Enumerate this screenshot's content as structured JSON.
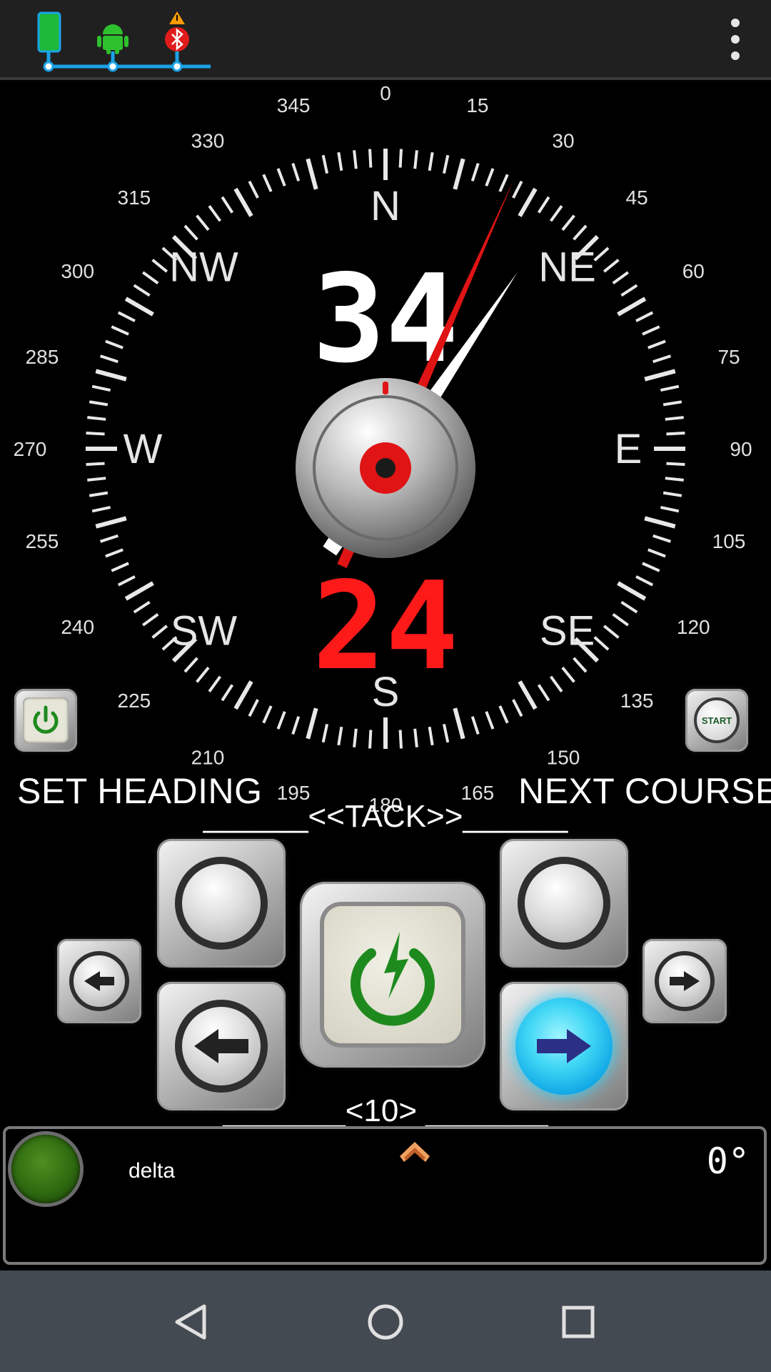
{
  "status": {
    "icons": [
      "phone-icon",
      "android-icon",
      "bluetooth-icon",
      "warning-icon"
    ],
    "accent_color": "#1aa3e8"
  },
  "menu": {
    "overflow": "overflow-menu-icon"
  },
  "compass": {
    "heading": "34",
    "course": "24",
    "heading_color": "#ffffff",
    "course_color": "#ff1a1a",
    "cardinals": {
      "N": "N",
      "NE": "NE",
      "E": "E",
      "SE": "SE",
      "S": "S",
      "SW": "SW",
      "W": "W",
      "NW": "NW"
    },
    "degree_labels": [
      "0",
      "15",
      "30",
      "45",
      "60",
      "75",
      "90",
      "105",
      "120",
      "135",
      "150",
      "165",
      "180",
      "195",
      "210",
      "225",
      "240",
      "255",
      "270",
      "285",
      "300",
      "315",
      "330",
      "345"
    ],
    "heading_needle_value": 34,
    "course_needle_value": 24
  },
  "controls": {
    "set_heading": "SET HEADING",
    "next_course": "NEXT COURSE",
    "start_label": "START",
    "tack": "______<<TACK>>______",
    "step": "_______<10> _______"
  },
  "info": {
    "mode": "delta",
    "degree": "0°",
    "led_color": "#3d7a18"
  },
  "nav": {
    "back": "back-icon",
    "home": "home-icon",
    "recents": "recents-icon"
  }
}
